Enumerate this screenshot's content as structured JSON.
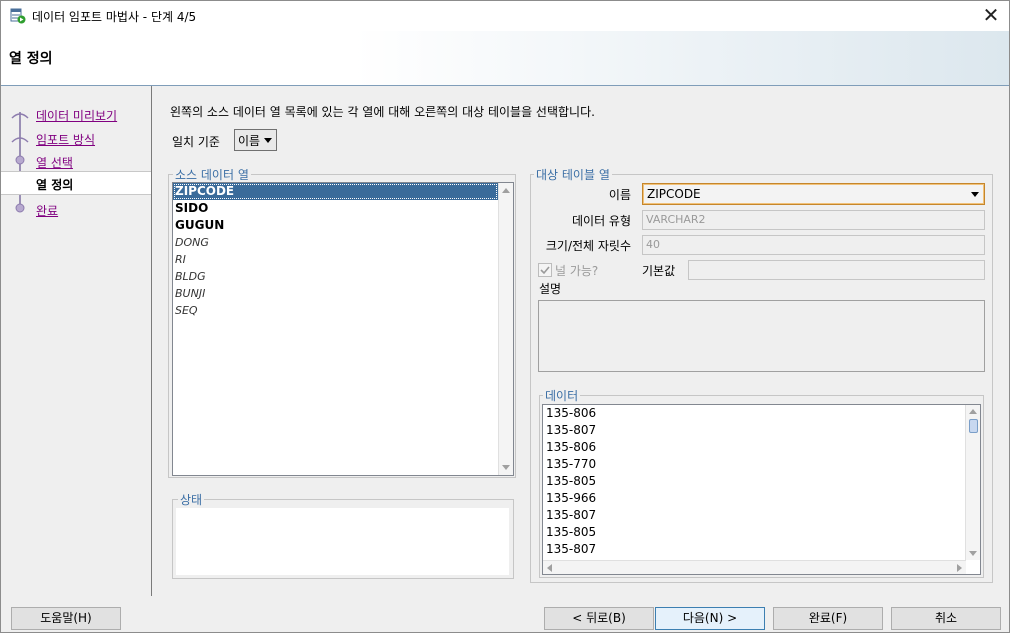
{
  "window": {
    "title": "데이터 임포트 마법사 - 단계 4/5",
    "close_glyph": "✕"
  },
  "header": {
    "title": "열 정의"
  },
  "nav": {
    "items": [
      {
        "label": "데이터 미리보기"
      },
      {
        "label": "임포트 방식"
      },
      {
        "label": "열 선택"
      },
      {
        "label": "열 정의"
      },
      {
        "label": "완료"
      }
    ],
    "current_index": 3
  },
  "main": {
    "instruction": "왼쪽의 소스 데이터 열 목록에 있는 각 열에 대해 오른쪽의 대상 테이블을 선택합니다.",
    "match_label": "일치 기준",
    "match_value": "이름",
    "source": {
      "group_label": "소스 데이터 열",
      "columns": [
        "ZIPCODE",
        "SIDO",
        "GUGUN",
        "DONG",
        "RI",
        "BLDG",
        "BUNJI",
        "SEQ"
      ],
      "selected": "ZIPCODE"
    },
    "status": {
      "group_label": "상태"
    },
    "target": {
      "group_label": "대상 테이블 열",
      "name_label": "이름",
      "name_value": "ZIPCODE",
      "type_label": "데이터 유형",
      "type_value": "VARCHAR2",
      "size_label": "크기/전체 자릿수",
      "size_value": "40",
      "nullable_label": "널 가능?",
      "nullable_checked": true,
      "default_label": "기본값",
      "default_value": "",
      "desc_label": "설명",
      "data_group_label": "데이터",
      "data_rows": [
        "135-806",
        "135-807",
        "135-806",
        "135-770",
        "135-805",
        "135-966",
        "135-807",
        "135-805",
        "135-807"
      ]
    }
  },
  "footer": {
    "help": "도움말(H)",
    "back": "< 뒤로(B)",
    "next": "다음(N) >",
    "finish": "완료(F)",
    "cancel": "취소"
  },
  "colors": {
    "selection": "#3a6b9a",
    "group_label": "#3a6ea5",
    "visited_link": "#800080"
  }
}
